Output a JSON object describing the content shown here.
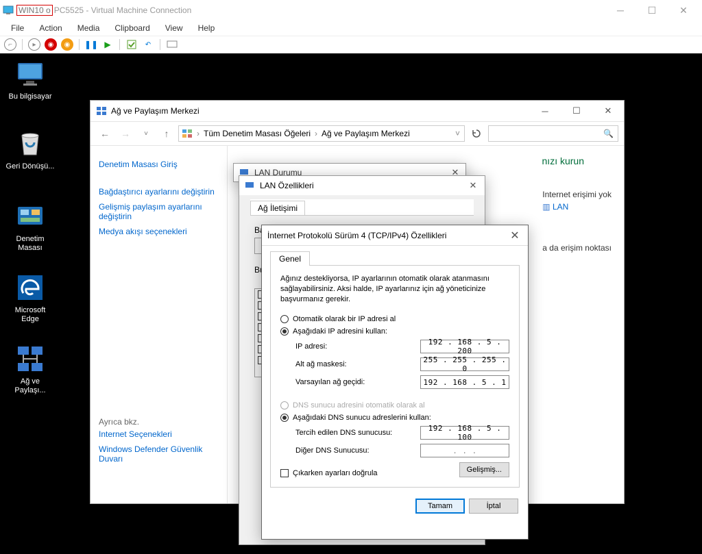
{
  "host": {
    "title_highlighted": "WIN10 o",
    "title_rest": "PC5525 - Virtual Machine Connection",
    "menu": {
      "file": "File",
      "action": "Action",
      "media": "Media",
      "clipboard": "Clipboard",
      "view": "View",
      "help": "Help"
    }
  },
  "desktop": {
    "this_pc": "Bu bilgisayar",
    "recycle": "Geri Dönüşü...",
    "control_panel": "Denetim Masası",
    "edge": "Microsoft Edge",
    "network": "Ağ ve Paylaşı..."
  },
  "nsc": {
    "title": "Ağ ve Paylaşım Merkezi",
    "bc1": "Tüm Denetim Masası Öğeleri",
    "bc2": "Ağ ve Paylaşım Merkezi",
    "side": {
      "home": "Denetim Masası Giriş",
      "adapter": "Bağdaştırıcı ayarlarını değiştirin",
      "sharing": "Gelişmiş paylaşım ayarlarını değiştirin",
      "media": "Medya akışı seçenekleri",
      "also": "Ayrıca bkz.",
      "inetopts": "Internet Seçenekleri",
      "defender": "Windows Defender Güvenlik Duvarı"
    },
    "heading_suffix": "nızı kurun",
    "no_internet": "Internet erişimi yok",
    "lan_link": "LAN",
    "ap_line": "a da erişim noktası"
  },
  "lan_status": {
    "title": "LAN Durumu"
  },
  "lan_props": {
    "title": "LAN Özellikleri",
    "tab": "Ağ İletişimi",
    "using_label": "Bağlanırken kullan:",
    "items_heading": "Bu"
  },
  "ipv4": {
    "title": "İnternet Protokolü Sürüm 4 (TCP/IPv4) Özellikleri",
    "tab": "Genel",
    "desc": "Ağınız destekliyorsa, IP ayarlarının otomatik olarak atanmasını sağlayabilirsiniz. Aksi halde, IP ayarlarınız için ağ yöneticinize başvurmanız gerekir.",
    "auto_ip": "Otomatik olarak bir IP adresi al",
    "use_ip": "Aşağıdaki IP adresini kullan:",
    "ip_label": "IP adresi:",
    "ip_value": "192 . 168 .   5 . 200",
    "mask_label": "Alt ağ maskesi:",
    "mask_value": "255 . 255 . 255 .   0",
    "gw_label": "Varsayılan ağ geçidi:",
    "gw_value": "192 . 168 .   5 .   1",
    "auto_dns": "DNS sunucu adresini otomatik olarak al",
    "use_dns": "Aşağıdaki DNS sunucu adreslerini kullan:",
    "dns1_label": "Tercih edilen DNS sunucusu:",
    "dns1_value": "192 . 168 .   5 . 100",
    "dns2_label": "Diğer DNS Sunucusu:",
    "dns2_value": ".       .       .",
    "validate": "Çıkarken ayarları doğrula",
    "advanced": "Gelişmiş...",
    "ok": "Tamam",
    "cancel": "İptal"
  }
}
